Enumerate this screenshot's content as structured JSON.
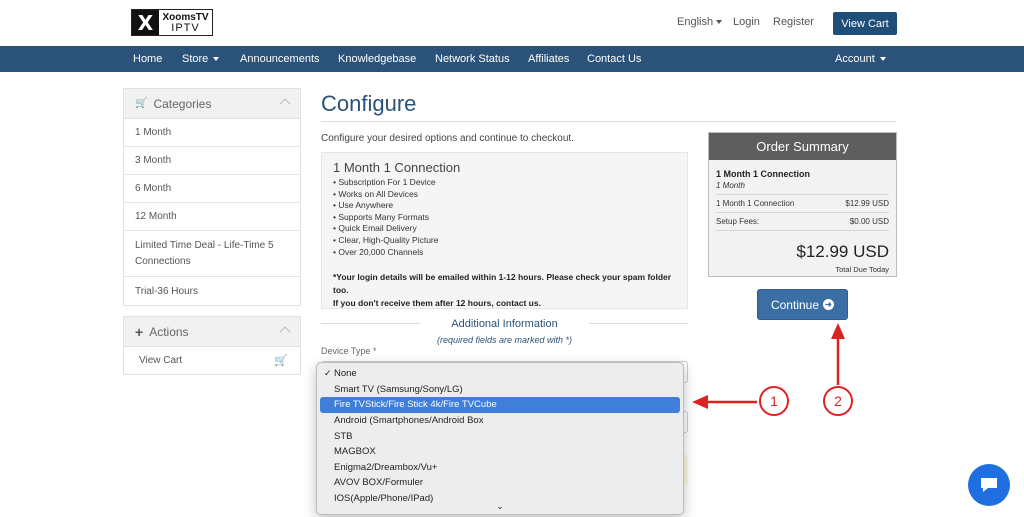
{
  "brand": {
    "line1": "XoomsTV",
    "line2": "IPTV",
    "mark": "X"
  },
  "topbar": {
    "language": "English",
    "login": "Login",
    "register": "Register",
    "view_cart": "View Cart"
  },
  "nav": {
    "home": "Home",
    "store": "Store",
    "announcements": "Announcements",
    "knowledgebase": "Knowledgebase",
    "network_status": "Network Status",
    "affiliates": "Affiliates",
    "contact": "Contact Us",
    "account": "Account"
  },
  "sidebar": {
    "categories_title": "Categories",
    "categories": [
      "1 Month",
      "3 Month",
      "6 Month",
      "12 Month",
      "Limited Time Deal - Life-Time 5 Connections",
      "Trial-36 Hours"
    ],
    "actions_title": "Actions",
    "actions": [
      "View Cart"
    ]
  },
  "main": {
    "title": "Configure",
    "subtitle": "Configure your desired options and continue to checkout.",
    "product_name": "1 Month 1 Connection",
    "features": [
      "• Subscription For 1 Device",
      "• Works on All Devices",
      "• Use Anywhere",
      "• Supports Many Formats",
      "• Quick Email Delivery",
      "• Clear, High-Quality Picture",
      "• Over 20,000 Channels"
    ],
    "note_line1": "*Your login details will be emailed within 1-12 hours. Please check your spam folder too.",
    "note_line2": "If you don't receive them after 12 hours, contact us.",
    "additional_title": "Additional Information",
    "required_note": "(required fields are marked with *)",
    "device_label": "Device Type *"
  },
  "device_dropdown": {
    "checked": "None",
    "highlighted": "Fire TVStick/Fire Stick 4k/Fire TVCube",
    "options": [
      "None",
      "Smart TV (Samsung/Sony/LG)",
      "Fire TVStick/Fire Stick 4k/Fire TVCube",
      "Android (Smartphones/Android Box",
      "STB",
      "MAGBOX",
      "Enigma2/Dreambox/Vu+",
      "AVOV BOX/Formuler",
      "IOS(Apple/Phone/IPad)"
    ]
  },
  "summary": {
    "title": "Order Summary",
    "product": "1 Month 1 Connection",
    "cycle": "1 Month",
    "line_label": "1 Month 1 Connection",
    "line_price": "$12.99 USD",
    "setup_label": "Setup Fees:",
    "setup_price": "$0.00 USD",
    "total": "$12.99 USD",
    "total_label": "Total Due Today"
  },
  "continue_label": "Continue",
  "annotations": {
    "callout1": "1",
    "callout2": "2",
    "color": "#dd2222"
  },
  "colors": {
    "brand_blue": "#2b5379",
    "button_blue": "#3a6ea5",
    "highlight": "#3f7ed9"
  }
}
